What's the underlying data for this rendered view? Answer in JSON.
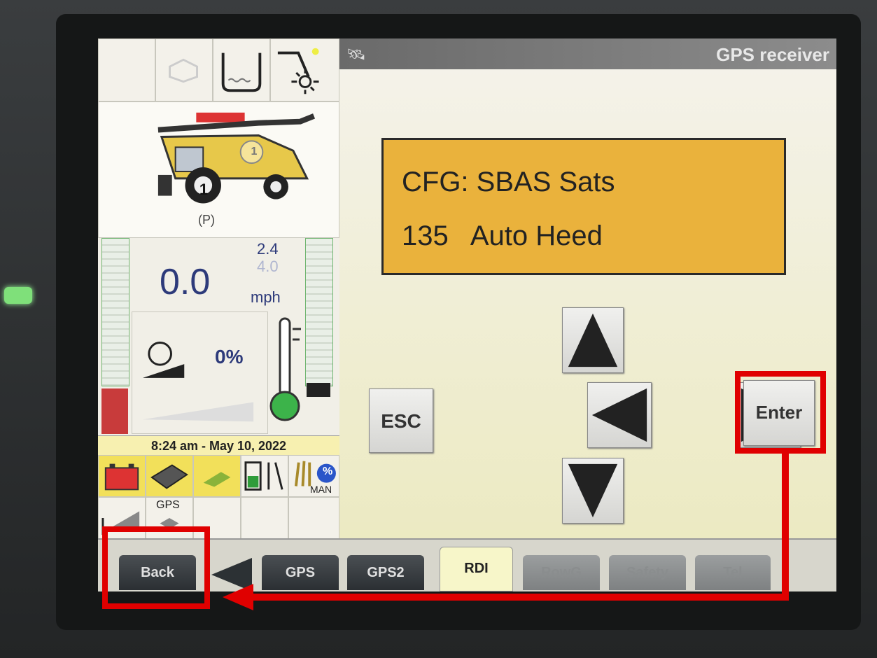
{
  "top_bar": {
    "title": "GPS receiver"
  },
  "left_panel": {
    "speed_value": "0.0",
    "speed_upper": "2.4",
    "speed_set": "4.0",
    "speed_unit": "mph",
    "park_label": "(P)",
    "combine_number": "1",
    "throttle_percent": "0%",
    "datetime": "8:24 am - May 10, 2022",
    "gps_label": "GPS",
    "man_label": "MAN",
    "percent_badge": "%"
  },
  "display": {
    "line1": "CFG: SBAS Sats",
    "line2": "135   Auto Heed"
  },
  "controls": {
    "esc_label": "ESC",
    "enter_label": "Enter",
    "back_label": "Back"
  },
  "tabs": [
    "GPS",
    "GPS2",
    "RDI",
    "RowG",
    "Safety",
    "Tel"
  ],
  "active_tab": "RDI",
  "colors": {
    "lcd_background": "#eab23c",
    "annotation": "#e00000",
    "active_tab": "#f7f6c9"
  }
}
